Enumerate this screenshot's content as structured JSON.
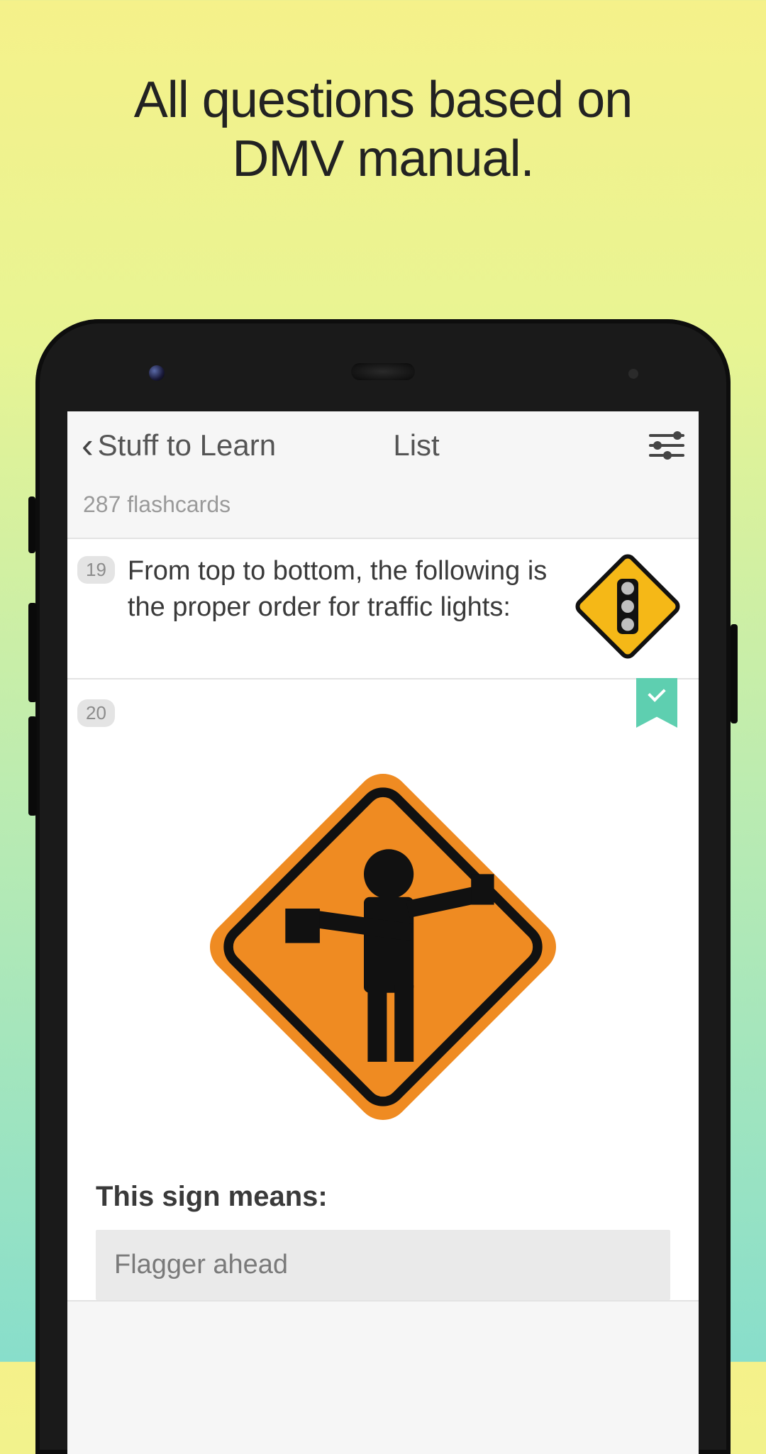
{
  "promo": {
    "line1": "All questions based on",
    "line2": "DMV manual."
  },
  "nav": {
    "back_label": "Stuff to Learn",
    "title": "List"
  },
  "count_label": "287 flashcards",
  "cards": [
    {
      "num": "19",
      "question": "From top to bottom, the following is the proper order for traffic lights:"
    },
    {
      "num": "20",
      "prompt": "This sign means:",
      "answer": "Flagger ahead"
    }
  ],
  "icons": {
    "traffic_light_sign": "traffic-light-warning-sign",
    "flagger_sign": "flagger-ahead-sign"
  },
  "colors": {
    "sign_yellow": "#f5b817",
    "sign_orange": "#ef8b22",
    "bookmark": "#5ecfb0"
  }
}
